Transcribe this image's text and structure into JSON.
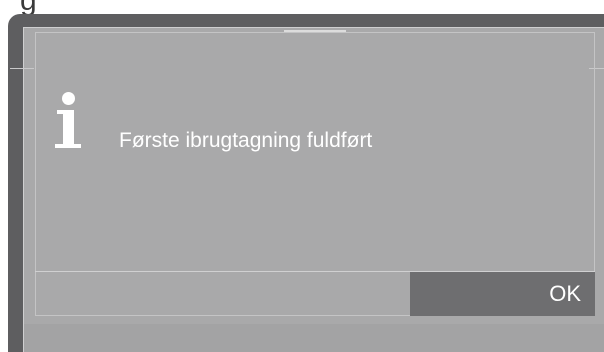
{
  "heading": {
    "text": "g"
  },
  "dialog": {
    "icon": "info-icon",
    "message": "Første ibrugtagning fuldført",
    "ok_label": "OK"
  },
  "colors": {
    "bezel": "#5e5e60",
    "screen": "#a9a9aa",
    "ok_button": "#6e6e70",
    "text": "#ffffff"
  }
}
